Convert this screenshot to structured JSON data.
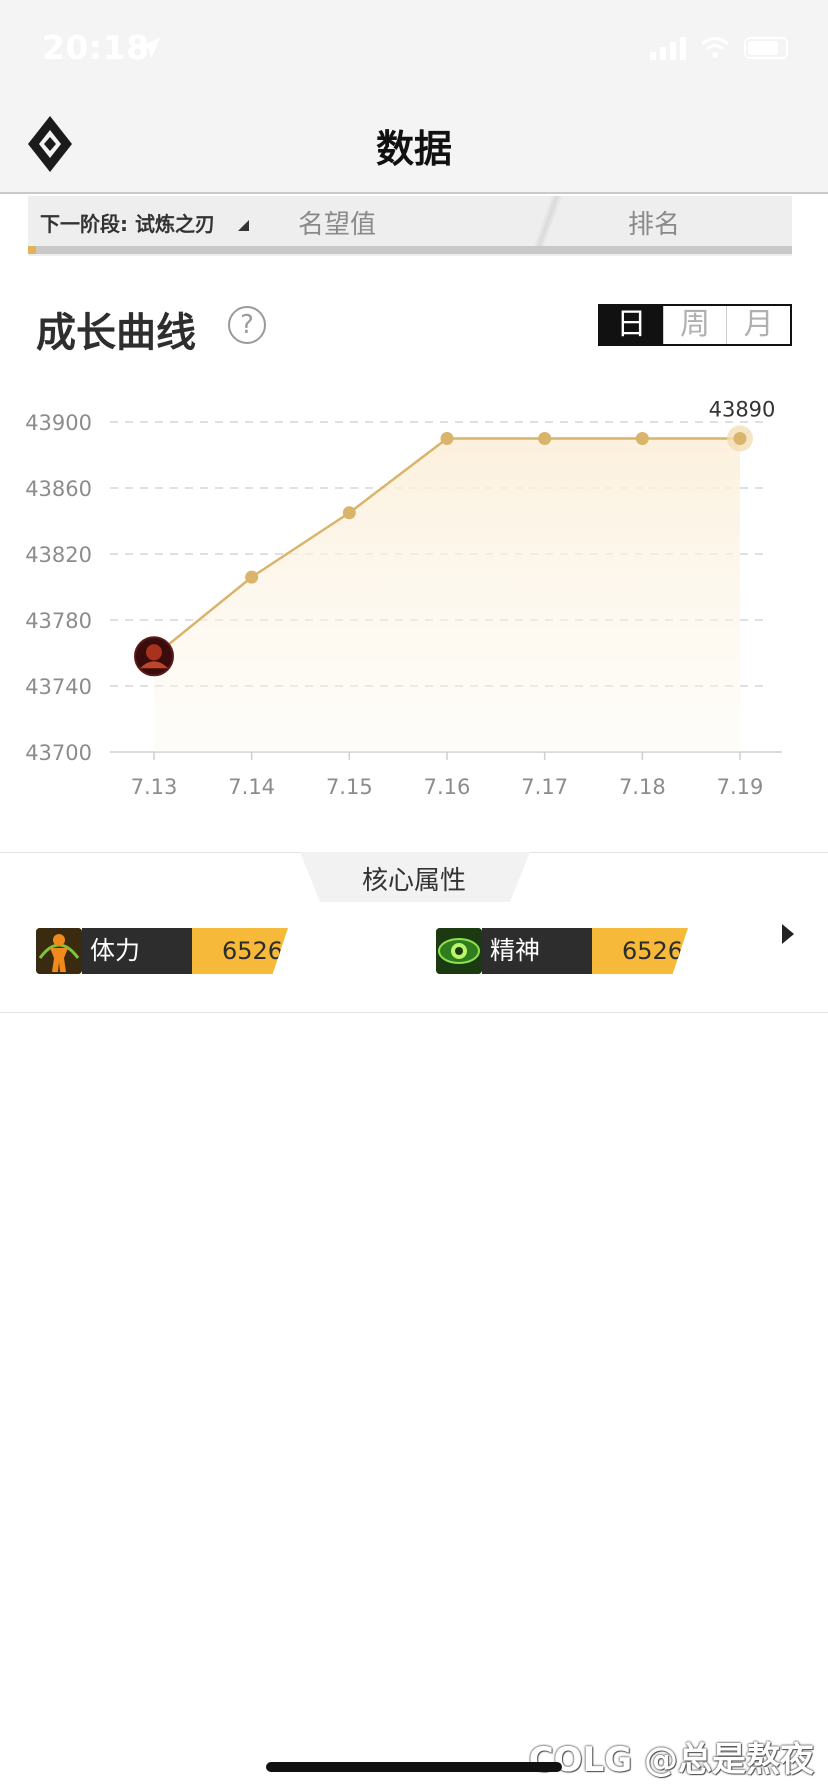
{
  "status_bar": {
    "time": "20:18"
  },
  "header": {
    "title": "数据"
  },
  "tabs": {
    "next_stage": "下一阶段: 试炼之刃",
    "fame": "名望值",
    "rank": "排名"
  },
  "growth": {
    "title": "成长曲线",
    "help_symbol": "?",
    "periods": [
      "日",
      "周",
      "月"
    ],
    "active_period": "日"
  },
  "chart_data": {
    "type": "line",
    "categories": [
      "7.13",
      "7.14",
      "7.15",
      "7.16",
      "7.17",
      "7.18",
      "7.19"
    ],
    "values": [
      43758,
      43806,
      43845,
      43890,
      43890,
      43890,
      43890
    ],
    "y_ticks": [
      43700,
      43740,
      43780,
      43820,
      43860,
      43900
    ],
    "ylim": [
      43700,
      43900
    ],
    "highlight_label": "43890",
    "line_color": "#d9b46a",
    "grid": "dashed-horizontal"
  },
  "core": {
    "title": "核心属性",
    "attributes": [
      {
        "name": "体力",
        "value": "6526",
        "icon": "stamina-icon"
      },
      {
        "name": "精神",
        "value": "6526",
        "icon": "spirit-eye-icon"
      }
    ]
  },
  "watermark": "COLG @总是熬夜"
}
